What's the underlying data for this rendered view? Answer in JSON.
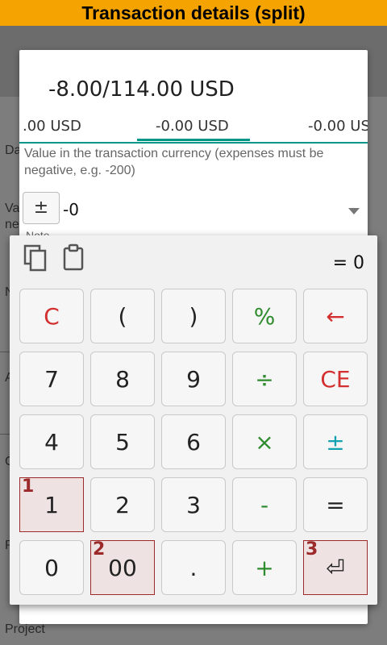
{
  "window_title": "Transaction details (split)",
  "background": {
    "fragments": [
      "Da",
      "Va",
      "ne",
      "N",
      "A",
      "C",
      "P",
      "Project"
    ]
  },
  "dialog": {
    "title": "-8.00/114.00 USD",
    "tabs": [
      ".00 USD",
      "-0.00 USD",
      "-0.00 US"
    ],
    "hint": "Value in the transaction currency (expenses must be negative, e.g. -200)",
    "sign_label": "±",
    "value": "-0",
    "note_label": "Note"
  },
  "calculator": {
    "result": "= 0",
    "keys": [
      {
        "label": "C",
        "color": "red"
      },
      {
        "label": "(",
        "color": "default"
      },
      {
        "label": ")",
        "color": "default"
      },
      {
        "label": "%",
        "color": "green"
      },
      {
        "label": "←",
        "color": "red"
      },
      {
        "label": "7",
        "color": "default"
      },
      {
        "label": "8",
        "color": "default"
      },
      {
        "label": "9",
        "color": "default"
      },
      {
        "label": "÷",
        "color": "green"
      },
      {
        "label": "CE",
        "color": "red"
      },
      {
        "label": "4",
        "color": "default"
      },
      {
        "label": "5",
        "color": "default"
      },
      {
        "label": "6",
        "color": "default"
      },
      {
        "label": "×",
        "color": "green"
      },
      {
        "label": "±",
        "color": "teal"
      },
      {
        "label": "1",
        "color": "default",
        "marker": "1"
      },
      {
        "label": "2",
        "color": "default"
      },
      {
        "label": "3",
        "color": "default"
      },
      {
        "label": "-",
        "color": "green"
      },
      {
        "label": "=",
        "color": "default"
      },
      {
        "label": "0",
        "color": "default"
      },
      {
        "label": "00",
        "color": "default",
        "marker": "2"
      },
      {
        "label": ".",
        "color": "default"
      },
      {
        "label": "+",
        "color": "green"
      },
      {
        "label": "⏎",
        "color": "default",
        "marker": "3"
      }
    ]
  },
  "colors": {
    "title_bar": "#f4a300",
    "accent": "#009688",
    "red": "#d32f2f",
    "green": "#2e8b2e",
    "teal": "#11a1b0",
    "marker": "#9c2a2a"
  }
}
